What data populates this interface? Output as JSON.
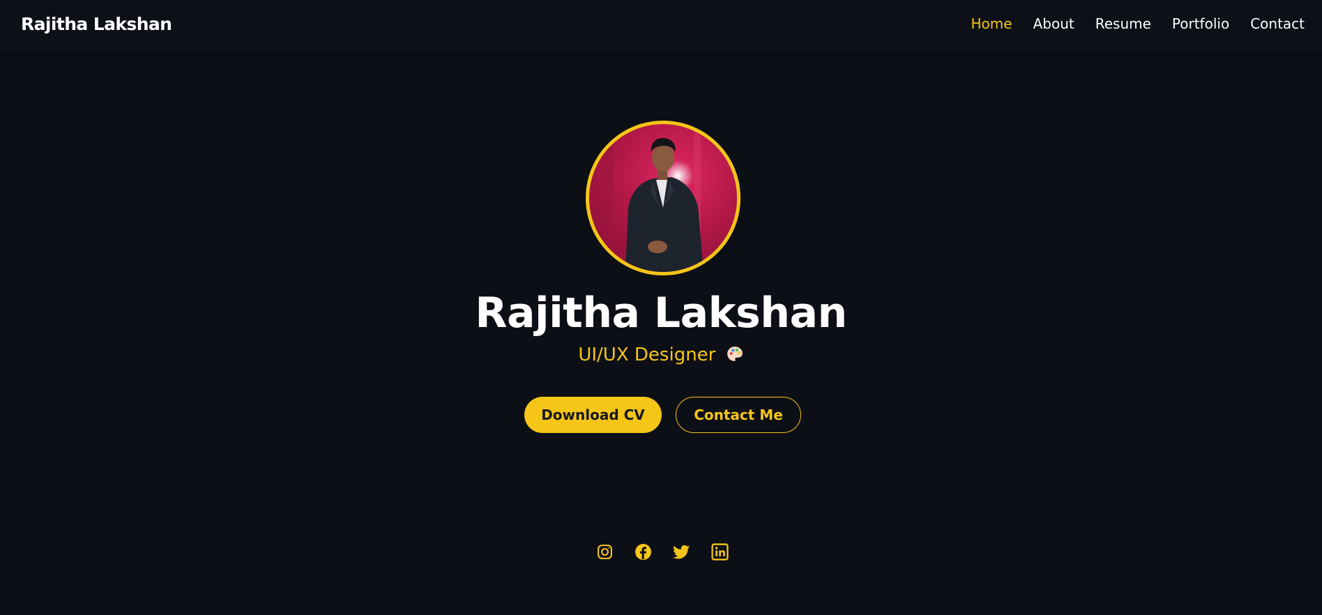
{
  "navbar": {
    "brand": "Rajitha Lakshan",
    "links": [
      {
        "label": "Home",
        "active": true
      },
      {
        "label": "About",
        "active": false
      },
      {
        "label": "Resume",
        "active": false
      },
      {
        "label": "Portfolio",
        "active": false
      },
      {
        "label": "Contact",
        "active": false
      }
    ]
  },
  "hero": {
    "avatar_icon": "profile-photo",
    "name": "Rajitha Lakshan",
    "role": "UI/UX Designer",
    "role_emoji": "palette-icon",
    "buttons": {
      "download_cv": "Download CV",
      "contact_me": "Contact Me"
    }
  },
  "socials": [
    {
      "name": "instagram-icon"
    },
    {
      "name": "facebook-icon"
    },
    {
      "name": "twitter-icon"
    },
    {
      "name": "linkedin-icon"
    }
  ],
  "colors": {
    "background": "#0d0f16",
    "accent": "#f5c518",
    "text": "#ffffff"
  }
}
